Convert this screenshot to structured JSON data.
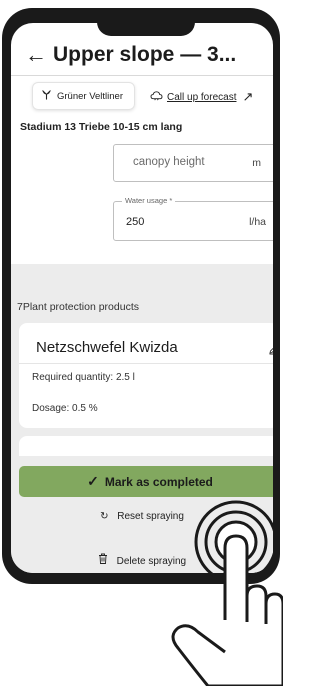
{
  "header": {
    "back_icon": "back-arrow-icon",
    "title": "Upper slope — 3..."
  },
  "variety_chip": {
    "icon": "grape-vine-icon",
    "label": "Grüner Veltliner"
  },
  "forecast": {
    "icon": "cloud-icon",
    "label": "Call up forecast",
    "arrow_icon": "arrow-up-right-icon"
  },
  "stage": "Stadium 13 Triebe 10-15 cm lang",
  "canopy_field": {
    "placeholder": "canopy height",
    "unit": "m"
  },
  "water_field": {
    "label": "Water usage *",
    "value": "250",
    "unit": "l/ha"
  },
  "products_section": {
    "title": "7Plant protection products"
  },
  "product": {
    "name": "Netzschwefel Kwizda",
    "quantity": "Required quantity: 2.5 l",
    "dosage": "Dosage: 0.5 %",
    "edit_icon": "pencil-icon"
  },
  "actions": {
    "complete_label": "Mark as completed",
    "reset_label": "Reset spraying",
    "delete_label": "Delete spraying"
  },
  "colors": {
    "primary_green": "#82a85f",
    "background_gray": "#ececec"
  }
}
